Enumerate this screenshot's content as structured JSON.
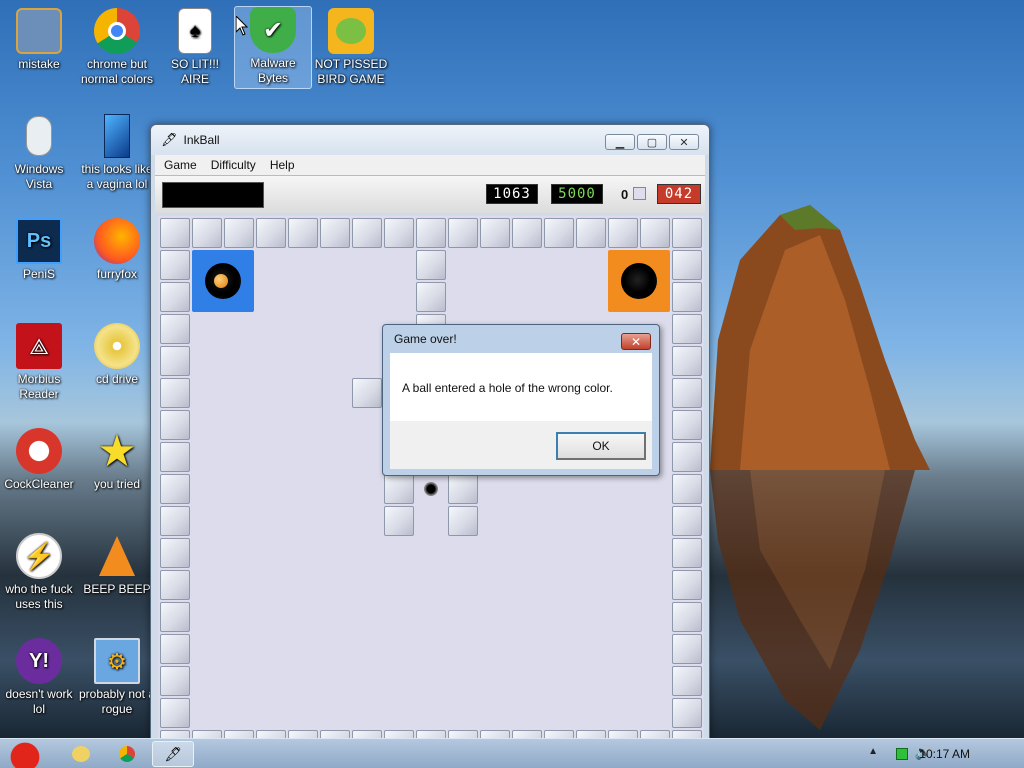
{
  "desktop": {
    "icons": [
      {
        "label": "mistake",
        "icon": "computer-folder-icon"
      },
      {
        "label": "chrome but normal colors",
        "icon": "chrome-icon"
      },
      {
        "label": "SO LIT!!! AIRE",
        "icon": "solitaire-icon"
      },
      {
        "label": "Malware Bytes",
        "icon": "shield-check-icon"
      },
      {
        "label": "NOT PISSED BIRD GAME",
        "icon": "green-pig-icon"
      },
      {
        "label": "Windows Vista",
        "icon": "robot-icon"
      },
      {
        "label": "this looks like a vagina lol",
        "icon": "blue-phone-icon"
      },
      {
        "label": "PeniS",
        "icon": "photoshop-icon"
      },
      {
        "label": "furryfox",
        "icon": "firefox-icon"
      },
      {
        "label": "Morbius Reader",
        "icon": "acrobat-icon"
      },
      {
        "label": "cd drive",
        "icon": "cd-icon"
      },
      {
        "label": "CockCleaner",
        "icon": "ccleaner-icon"
      },
      {
        "label": "you tried",
        "icon": "star-icon"
      },
      {
        "label": "who the fuck uses this",
        "icon": "lightning-icon"
      },
      {
        "label": "BEEP BEEP",
        "icon": "vlc-cone-icon"
      },
      {
        "label": "doesn't work lol",
        "icon": "yahoo-messenger-icon"
      },
      {
        "label": "probably not a rogue",
        "icon": "gears-monitor-icon"
      }
    ]
  },
  "window": {
    "title": "InkBall",
    "menu": [
      "Game",
      "Difficulty",
      "Help"
    ],
    "score": "1063",
    "target": "5000",
    "balls_left": "0",
    "timer": "042"
  },
  "dialog": {
    "title": "Game over!",
    "message": "A ball entered a hole of the wrong color.",
    "ok_label": "OK"
  },
  "taskbar": {
    "clock": "10:17 AM"
  },
  "colors": {
    "blue_hole": "#2f7fe6",
    "orange_hole": "#f28c1e",
    "score_green": "#7ed957",
    "timer_red": "#c63a2a"
  }
}
